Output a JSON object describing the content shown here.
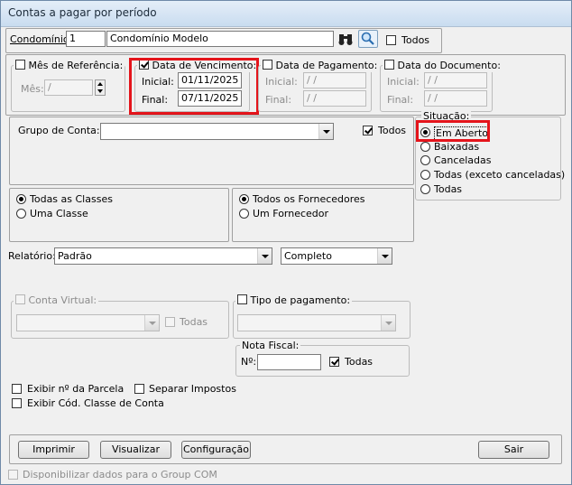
{
  "window": {
    "title": "Contas a pagar por período"
  },
  "condominio": {
    "label": "Condomínio:",
    "code": "1",
    "name": "Condomínio Modelo",
    "todos_label": "Todos"
  },
  "mes_referencia": {
    "label": "Mês de Referência:",
    "mes_label": "Mês:",
    "mes_value": "  /"
  },
  "data_vencimento": {
    "label": "Data de Vencimento:",
    "inicial_label": "Inicial:",
    "inicial_value": "01/11/2025",
    "final_label": "Final:",
    "final_value": "07/11/2025"
  },
  "data_pagamento": {
    "label": "Data de Pagamento:",
    "inicial_label": "Inicial:",
    "inicial_value": "  /  /",
    "final_label": "Final:",
    "final_value": "  /  /"
  },
  "data_documento": {
    "label": "Data do Documento:",
    "inicial_label": "Inicial:",
    "inicial_value": "  /  /",
    "final_label": "Final:",
    "final_value": "  /  /"
  },
  "grupo_conta": {
    "label": "Grupo de Conta:",
    "value": "",
    "todos_label": "Todos"
  },
  "situacao": {
    "label": "Situação:",
    "options": [
      "Em Aberto",
      "Baixadas",
      "Canceladas",
      "Todas (exceto canceladas)",
      "Todas"
    ]
  },
  "classes": {
    "options": [
      "Todas as Classes",
      "Uma Classe"
    ]
  },
  "fornecedores": {
    "options": [
      "Todos os Fornecedores",
      "Um Fornecedor"
    ]
  },
  "relatorio": {
    "label": "Relatório:",
    "value": "Padrão",
    "tipo_value": "Completo"
  },
  "conta_virtual": {
    "label": "Conta Virtual:",
    "todas_label": "Todas"
  },
  "tipo_pagamento": {
    "label": "Tipo de pagamento:"
  },
  "nota_fiscal": {
    "label": "Nota Fiscal:",
    "numero_label": "Nº:",
    "value": "",
    "todas_label": "Todas"
  },
  "options": {
    "exibir_parcela": "Exibir nº da Parcela",
    "separar_impostos": "Separar Impostos",
    "exibir_cod_classe": "Exibir Cód. Classe de Conta"
  },
  "buttons": {
    "imprimir": "Imprimir",
    "visualizar": "Visualizar",
    "configuracao": "Configuração",
    "sair": "Sair"
  },
  "footer": {
    "group_com_label": "Disponibilizar dados para o Group COM"
  },
  "colors": {
    "highlight": "#e4141b"
  }
}
